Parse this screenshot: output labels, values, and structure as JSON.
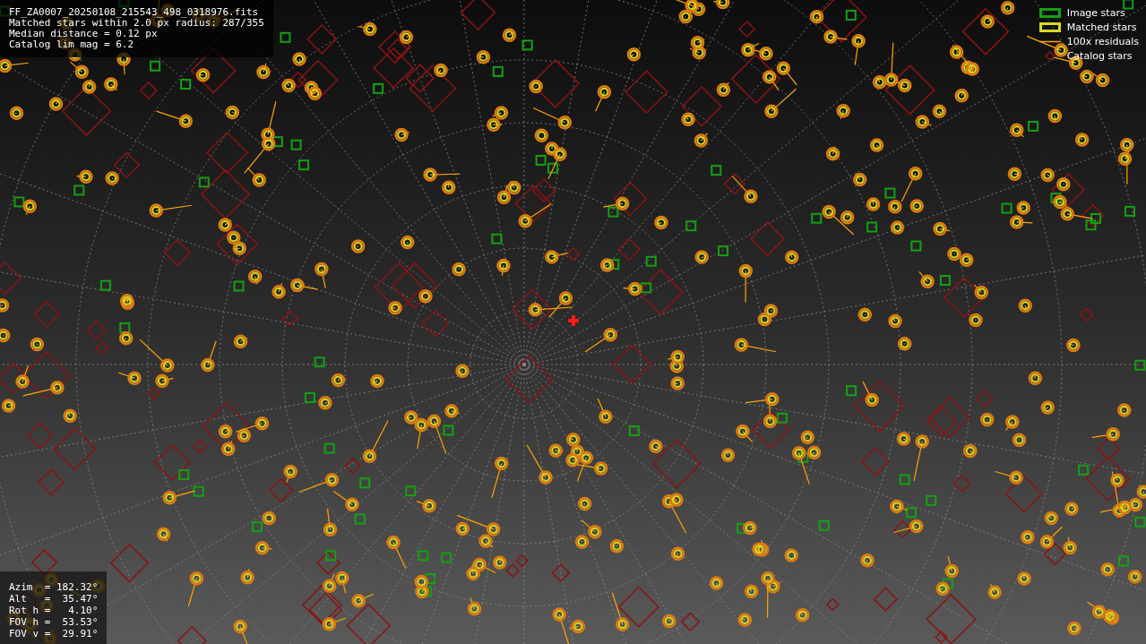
{
  "info": {
    "lines": [
      "FF_ZA0007_20250108_215543_498_0318976.fits",
      "Matched stars within 2.0 px radius: 287/355",
      "Median distance = 0.12 px",
      "Catalog lim mag = 6.2"
    ]
  },
  "pointing": {
    "lines": [
      "Azim  = 182.32°",
      "Alt   =  35.47°",
      "Rot h =   4.10°",
      "FOV h =  53.53°",
      "FOV v =  29.91°"
    ]
  },
  "legend": [
    {
      "label": "Image stars",
      "kind": "image"
    },
    {
      "label": "Matched stars",
      "kind": "matched"
    },
    {
      "label": "100x residuals",
      "kind": "residual"
    },
    {
      "label": "Catalog stars",
      "kind": "catalog"
    }
  ]
}
